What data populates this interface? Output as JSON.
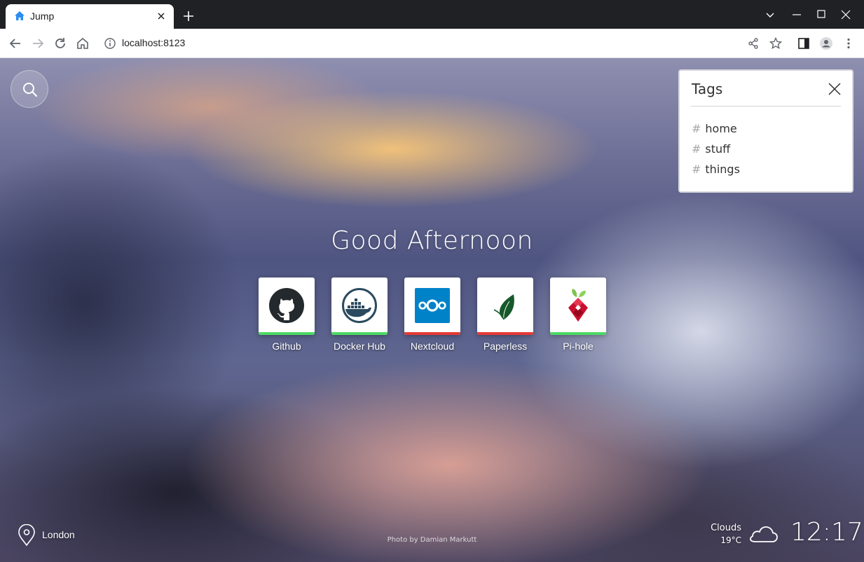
{
  "browser": {
    "tab_title": "Jump",
    "url": "localhost:8123",
    "icons": [
      "home-favicon-icon",
      "close-icon",
      "plus-icon",
      "chevron-down-icon",
      "minimize-icon",
      "maximize-icon",
      "close-window-icon",
      "back-icon",
      "forward-icon",
      "reload-icon",
      "home-icon",
      "info-icon",
      "share-icon",
      "star-icon",
      "side-panel-icon",
      "profile-icon",
      "menu-icon"
    ]
  },
  "page": {
    "greeting": "Good Afternoon",
    "sites": [
      {
        "label": "Github",
        "status_color": "#4cd964",
        "icon": "github-icon"
      },
      {
        "label": "Docker Hub",
        "status_color": "#4cd964",
        "icon": "docker-icon"
      },
      {
        "label": "Nextcloud",
        "status_color": "#e53935",
        "icon": "nextcloud-icon"
      },
      {
        "label": "Paperless",
        "status_color": "#e53935",
        "icon": "paperless-leaf-icon"
      },
      {
        "label": "Pi-hole",
        "status_color": "#4cd964",
        "icon": "pihole-icon"
      }
    ],
    "tags": {
      "title": "Tags",
      "items": [
        "home",
        "stuff",
        "things"
      ]
    },
    "footer": {
      "location": "London",
      "credit": "Photo by Damian Markutt",
      "weather_desc": "Clouds",
      "weather_temp": "19°C",
      "clock": "12:17"
    }
  }
}
